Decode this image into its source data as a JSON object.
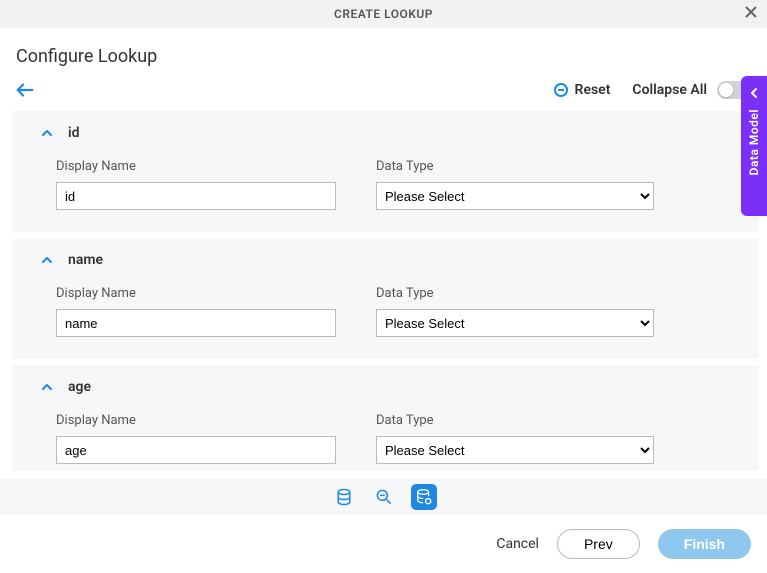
{
  "modal": {
    "title": "CREATE LOOKUP"
  },
  "page": {
    "title": "Configure Lookup"
  },
  "toolbar": {
    "reset_label": "Reset",
    "collapse_label": "Collapse All"
  },
  "side_panel": {
    "label": "Data Model"
  },
  "fields": [
    {
      "name": "id",
      "display_label": "Display Name",
      "display_value": "id",
      "type_label": "Data Type",
      "type_value": "Please Select"
    },
    {
      "name": "name",
      "display_label": "Display Name",
      "display_value": "name",
      "type_label": "Data Type",
      "type_value": "Please Select"
    },
    {
      "name": "age",
      "display_label": "Display Name",
      "display_value": "age",
      "type_label": "Data Type",
      "type_value": "Please Select"
    }
  ],
  "footer": {
    "cancel_label": "Cancel",
    "prev_label": "Prev",
    "finish_label": "Finish"
  }
}
